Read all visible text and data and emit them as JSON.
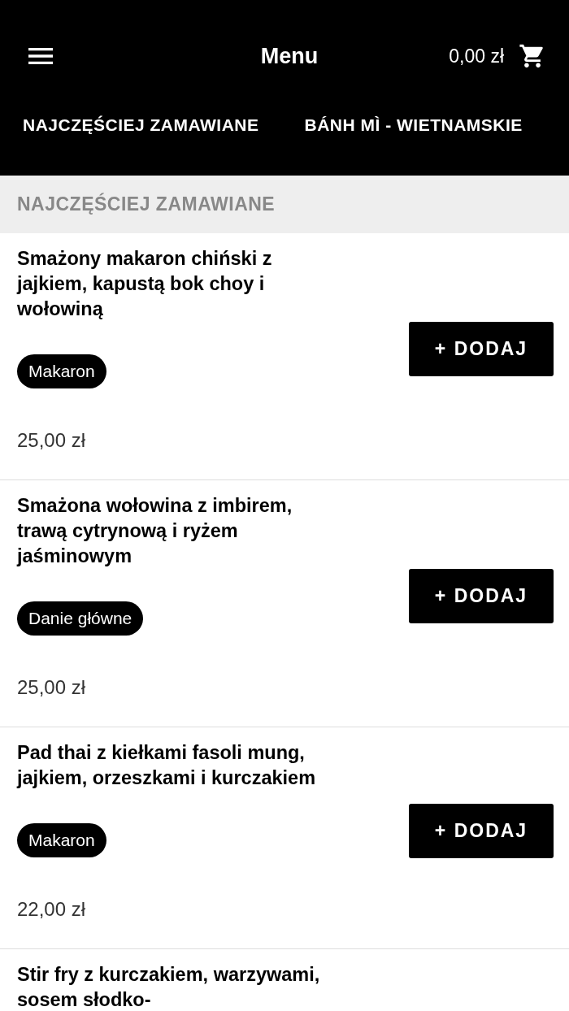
{
  "header": {
    "title": "Menu",
    "cart_total": "0,00 zł"
  },
  "tabs": [
    {
      "label": "NAJCZĘŚCIEJ ZAMAWIANE"
    },
    {
      "label": "BÁNH MÌ - WIETNAMSKIE"
    }
  ],
  "section": {
    "title": "NAJCZĘŚCIEJ ZAMAWIANE"
  },
  "items": [
    {
      "name": "Smażony makaron chiński z jajkiem, kapustą bok choy i wołowiną",
      "tag": "Makaron",
      "price": "25,00 zł",
      "button": "+ DODAJ"
    },
    {
      "name": "Smażona wołowina z imbirem, trawą cytrynową i ryżem jaśminowym",
      "tag": "Danie główne",
      "price": "25,00 zł",
      "button": "+ DODAJ"
    },
    {
      "name": "Pad thai z kiełkami fasoli mung, jajkiem, orzeszkami i kurczakiem",
      "tag": "Makaron",
      "price": "22,00 zł",
      "button": "+ DODAJ"
    },
    {
      "name": "Stir fry z kurczakiem, warzywami, sosem słodko-"
    }
  ]
}
